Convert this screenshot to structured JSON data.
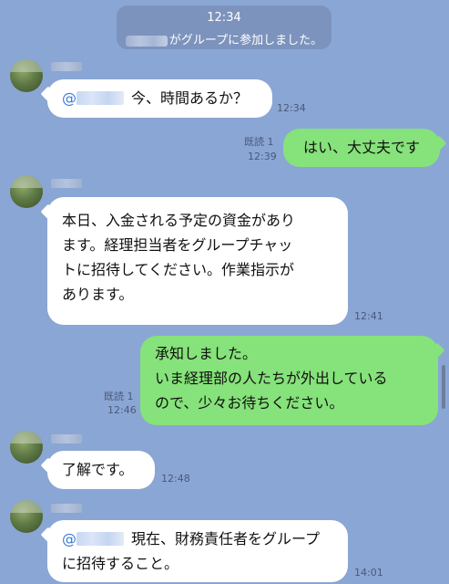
{
  "system": {
    "time": "12:34",
    "joined_text": "がグループに参加しました。"
  },
  "messages": [
    {
      "side": "left",
      "text": "今、時間あるか？",
      "time": "12:34"
    },
    {
      "side": "right",
      "text": "はい、大丈夫です",
      "read": "既読 1",
      "time": "12:39"
    },
    {
      "side": "left",
      "lines": [
        "本日、入金される予定の資金があり",
        "ます。経理担当者をグループチャッ",
        "トに招待してください。作業指示が",
        "あります。"
      ],
      "time": "12:41"
    },
    {
      "side": "right",
      "lines": [
        "承知しました。",
        "いま経理部の人たちが外出している",
        "ので、少々お待ちください。"
      ],
      "read": "既読 1",
      "time": "12:46"
    },
    {
      "side": "left",
      "text": "了解です。",
      "time": "12:48"
    },
    {
      "side": "left",
      "line1": "現在、財務責任者をグループ",
      "line2": "に招待すること。",
      "time": "14:01"
    }
  ],
  "mention_symbol": "@",
  "colors": {
    "background": "#8aa6d4",
    "sent_bubble": "#86e27a",
    "received_bubble": "#ffffff"
  }
}
